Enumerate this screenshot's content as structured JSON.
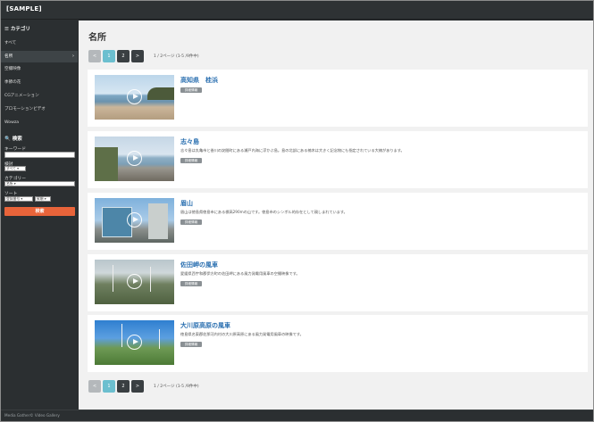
{
  "app": {
    "brand": "[SAMPLE]"
  },
  "sidebar": {
    "category_heading": "☰ カテゴリ",
    "items": [
      {
        "label": "すべて"
      },
      {
        "label": "名所",
        "active": true
      },
      {
        "label": "空撮映像"
      },
      {
        "label": "季節の花"
      },
      {
        "label": "CGアニメーション"
      },
      {
        "label": "プロモーションビデオ"
      },
      {
        "label": "Wowza"
      }
    ],
    "search": {
      "heading": "🔍 検索",
      "keyword_label": "キーワード",
      "keyword_value": "",
      "year_label": "検討",
      "year_value": "すべて ▾",
      "category_label": "カテゴリー",
      "category_value": "名所 ▾",
      "sort_label": "ソート",
      "sort_value": "登録番号 ▾",
      "order_value": "昇順 ▾",
      "button": "検索"
    }
  },
  "main": {
    "title": "名所",
    "pager": {
      "prev": "<",
      "pages": [
        "1",
        "2"
      ],
      "current": "1",
      "next": ">",
      "info": "1 / 2ページ (1-5 /9件中)"
    },
    "items": [
      {
        "title": "高知県　桂浜",
        "desc": "",
        "detail": "詳細情報"
      },
      {
        "title": "志々島",
        "desc": "志々島は丸亀市と香川の詫間町にある瀬戸内海に浮かぶ島。島の北部にある楠木は大きく記念物にも指定されている大楠があります。",
        "detail": "詳細情報"
      },
      {
        "title": "眉山",
        "desc": "眉山は徳島県徳島市にある標高290mの山です。徳島市のシンボル的存在として親しまれています。",
        "detail": "詳細情報"
      },
      {
        "title": "佐田岬の風車",
        "desc": "愛媛県西宇和郡伊方町の佐田岬にある風力発電用風車の空撮映像です。",
        "detail": "詳細情報"
      },
      {
        "title": "大川原高原の風車",
        "desc": "徳島県名東郡佐那河内村の大川原高原にある風力発電用風車の映像です。",
        "detail": "詳細情報"
      }
    ]
  },
  "footer": {
    "text": "Media Gather© Video Gallery"
  },
  "colors": {
    "accent": "#6cbfcf",
    "search_button": "#e8643a",
    "sidebar": "#2b2f31",
    "link": "#2a6fb0"
  }
}
